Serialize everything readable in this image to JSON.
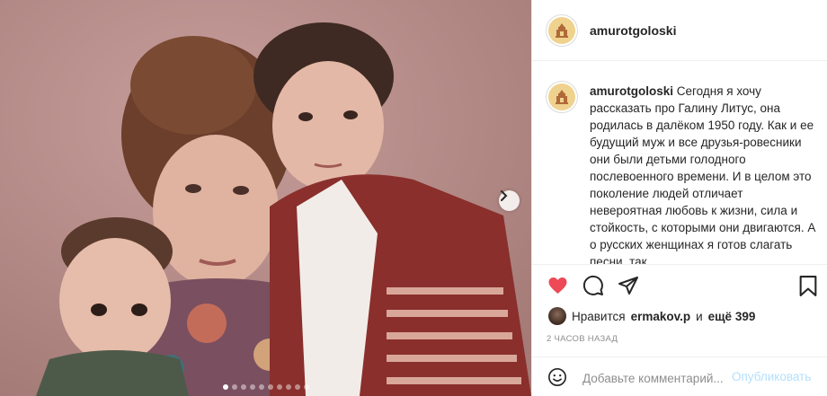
{
  "post": {
    "username": "amurotgoloski",
    "caption_text": "Сегодня я хочу рассказать про Галину Литус, она родилась в далёком 1950 году. Как и ее будущий муж и все друзья-ровесники они были детьми голодного послевоенного времени. И в целом это поколение людей отличает невероятная любовь к жизни, сила и стойкость, с которыми они двигаются. А о русских женщинах я готов слагать песни, так",
    "likes_prefix": "Нравится",
    "likes_user": "ermakov.p",
    "likes_middle": "и",
    "likes_count": "ещё 399",
    "timestamp": "2 ЧАСОВ НАЗАД"
  },
  "comment": {
    "placeholder": "Добавьте комментарий...",
    "publish_label": "Опубликовать"
  },
  "carousel": {
    "total": 10,
    "active": 1
  },
  "icons": {
    "like": "heart-icon",
    "comment": "comment-icon",
    "share": "share-icon",
    "save": "bookmark-icon",
    "emoji": "emoji-icon",
    "next": "chevron-right-icon"
  },
  "colors": {
    "like_active": "#ed4956",
    "publish_disabled": "#b2dffc",
    "avatar_ring": "#f0d28f",
    "muted_text": "#8e8e8e"
  }
}
